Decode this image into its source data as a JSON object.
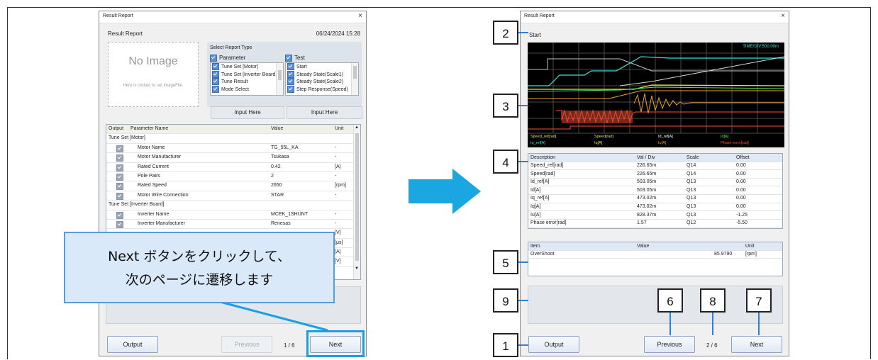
{
  "left_window": {
    "title": "Result Report",
    "close": "×",
    "header_label": "Result Report",
    "date": "06/24/2024 15:28",
    "image_box": {
      "title": "No Image",
      "hint": "Here is clicked to set ImageFile."
    },
    "report_type": {
      "label": "Select Report Type",
      "parameter_label": "Parameter",
      "test_label": "Test",
      "parameter_items": [
        "Tune Set [Motor]",
        "Tune Set [Inverter Board]",
        "Tune Result",
        "Mode Select"
      ],
      "test_items": [
        "Start",
        "Steady State(Scale1)",
        "Steady State(Scale2)",
        "Step Response(Speed)"
      ]
    },
    "input_here_1": "Input Here",
    "input_here_2": "Input Here",
    "param_table": {
      "headers": [
        "Output",
        "Parameter Name",
        "Value",
        "Unit"
      ],
      "rows": [
        {
          "group": "Tune Set [Motor]"
        },
        {
          "name": "Motor Name",
          "value": "TG_55L_KA",
          "unit": "-"
        },
        {
          "name": "Motor Manufacturer",
          "value": "Tsukasa",
          "unit": "-"
        },
        {
          "name": "Rated Current",
          "value": "0.42",
          "unit": "[A]"
        },
        {
          "name": "Pole Pairs",
          "value": "2",
          "unit": "-"
        },
        {
          "name": "Rated Speed",
          "value": "2650",
          "unit": "[rpm]"
        },
        {
          "name": "Motor Wire Connection",
          "value": "STAR",
          "unit": "-"
        },
        {
          "group": "Tune Set [Inverter Board]"
        },
        {
          "name": "Inverter Name",
          "value": "MCEK_1SHUNT",
          "unit": "-"
        },
        {
          "name": "Inverter Manufacturer",
          "value": "Renesas",
          "unit": "-"
        }
      ],
      "hidden_units": [
        "[V]",
        "[μs]",
        "[A]",
        "[V]"
      ]
    },
    "callout_line1": "Next ボタンをクリックして、",
    "callout_line2": "次のページに遷移します",
    "output_button": "Output",
    "previous_button": "Previous",
    "page": "1 / 6",
    "next_button": "Next"
  },
  "right_window": {
    "title": "Result Report",
    "close": "×",
    "section_label": "Start",
    "scope": {
      "time_div": "TIME/DIV:500.00m",
      "legend_row1": [
        "Speed_ref[rad]",
        "Speed[rad]",
        "Id_ref[A]",
        "Id[A]"
      ],
      "legend_row2": [
        "Iq_ref[A]",
        "Iq[A]",
        "Iu[A]",
        "Phase error[rad]"
      ],
      "colors": {
        "cyan": "#39e3d6",
        "yellow": "#e8e24a",
        "orange": "#f0a030",
        "red": "#ff4a3a",
        "green": "#55e055",
        "grid": "#4a4a4a"
      }
    },
    "scale_table": {
      "headers": [
        "Description",
        "Val / Div",
        "Scale",
        "Offset"
      ],
      "rows": [
        [
          "Speed_ref[rad]",
          "226.65m",
          "Q14",
          "0.00"
        ],
        [
          "Speed[rad]",
          "226.65m",
          "Q14",
          "0.00"
        ],
        [
          "Id_ref[A]",
          "503.05m",
          "Q13",
          "0.00"
        ],
        [
          "Id[A]",
          "503.05m",
          "Q13",
          "0.00"
        ],
        [
          "Iq_ref[A]",
          "473.02m",
          "Q13",
          "0.00"
        ],
        [
          "Iq[A]",
          "473.02m",
          "Q13",
          "0.00"
        ],
        [
          "Iu[A]",
          "828.37m",
          "Q13",
          "-1.25"
        ],
        [
          "Phase error[rad]",
          "1.57",
          "Q12",
          "-5.50"
        ]
      ]
    },
    "result_table": {
      "headers": [
        "Item",
        "Value",
        "Unit"
      ],
      "rows": [
        [
          "OverShoot",
          "85.9790",
          "[rpm]"
        ]
      ]
    },
    "output_button": "Output",
    "previous_button": "Previous",
    "page": "2 / 6",
    "next_button": "Next"
  },
  "callout_numbers": [
    "1",
    "2",
    "3",
    "4",
    "5",
    "6",
    "7",
    "8",
    "9"
  ],
  "arrow_color": "#1aa6e0"
}
